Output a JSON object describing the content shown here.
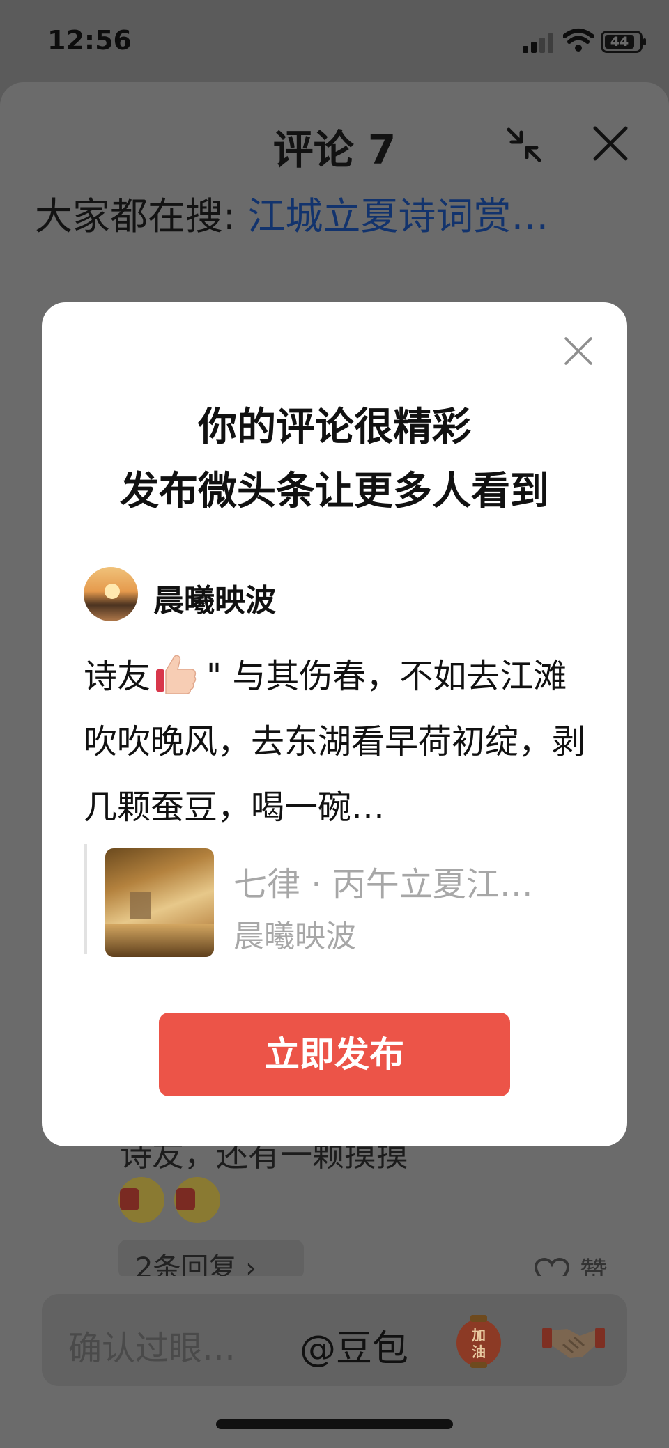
{
  "status_bar": {
    "time": "12:56",
    "battery": "44"
  },
  "sheet": {
    "title": "评论 7",
    "search_label": "大家都在搜: ",
    "search_link": "江城立夏诗词赏…",
    "bg_comment_fragment": "诗友，还有一颗摸摸",
    "replies_label": "2条回复 ›",
    "like_label": "赞"
  },
  "dialog": {
    "title_line1": "你的评论很精彩",
    "title_line2": "发布微头条让更多人看到",
    "author_name": "晨曦映波",
    "comment_prefix": "诗友",
    "comment_body": "\" 与其伤春，不如去江滩吹吹晚风，去东湖看早荷初绽，剥几颗蚕豆，喝一碗…",
    "article_title": "七律 · 丙午立夏江…",
    "article_author": "晨曦映波",
    "publish_button": "立即发布"
  },
  "input_bar": {
    "placeholder": "确认过眼…",
    "mention": "@豆包",
    "cheer_text": "加油"
  },
  "colors": {
    "accent": "#ec5448",
    "link": "#12336d",
    "overlay": "#5b5b5b"
  }
}
